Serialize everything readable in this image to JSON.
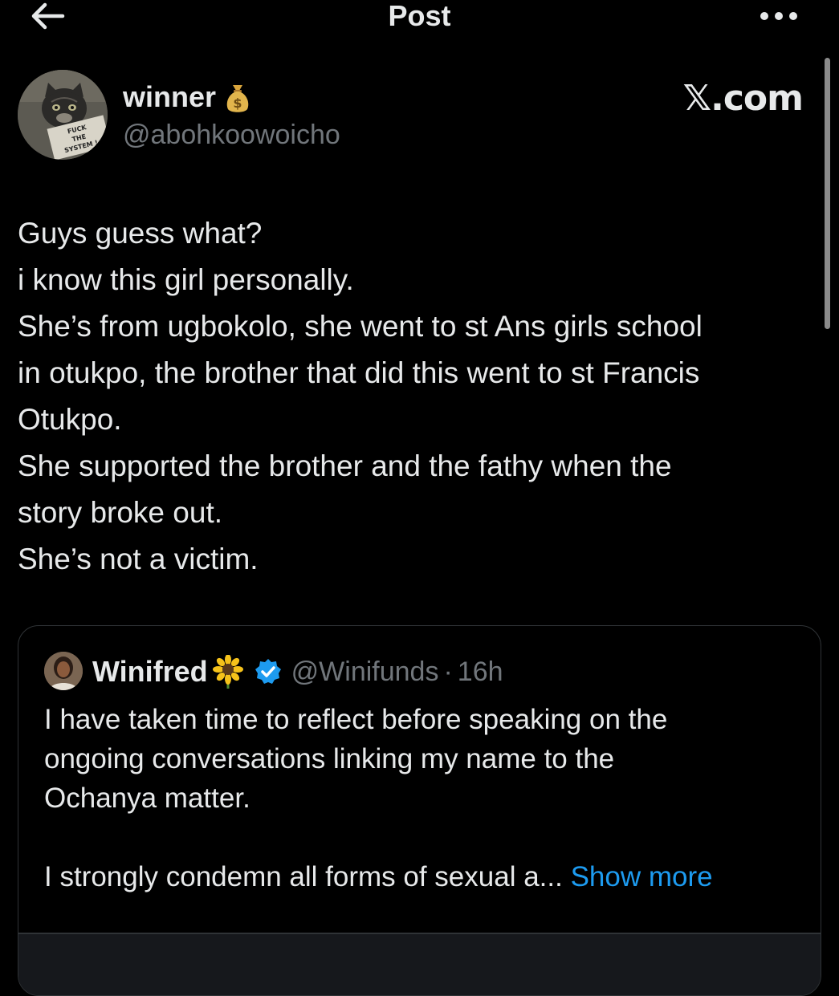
{
  "header": {
    "title": "Post",
    "back_icon": "arrow-left-icon",
    "more_icon": "more-horizontal-icon"
  },
  "post": {
    "author": {
      "display_name": "winner",
      "name_emoji": "money-bag-icon",
      "handle": "@abohkoowoicho",
      "avatar_sign_text": "FUCK THE SYSTEM !"
    },
    "watermark": "𝕏.com",
    "lines": [
      "Guys guess what?",
      "i know this girl personally.",
      "She’s from ugbokolo, she went to st Ans girls school",
      "in otukpo, the brother that did this went to st Francis",
      "Otukpo.",
      "She supported the brother and the fathy when the",
      "story broke out.",
      "She’s not a victim."
    ]
  },
  "quoted_post": {
    "author": {
      "display_name": "Winifred",
      "name_emoji": "sunflower-icon",
      "verified_icon": "verified-badge-icon",
      "handle": "@Winifunds",
      "separator": "·",
      "time": "16h"
    },
    "lines": [
      "I have taken time to reflect before speaking on the",
      "ongoing conversations linking my name to the",
      "Ochanya matter."
    ],
    "last_line": "I strongly condemn all forms of sexual a...",
    "show_more_label": "Show more"
  },
  "colors": {
    "background": "#000000",
    "text": "#e7e9ea",
    "secondary": "#71767b",
    "link": "#1d9bf0",
    "verified": "#1d9bf0",
    "border": "#2f3336"
  }
}
